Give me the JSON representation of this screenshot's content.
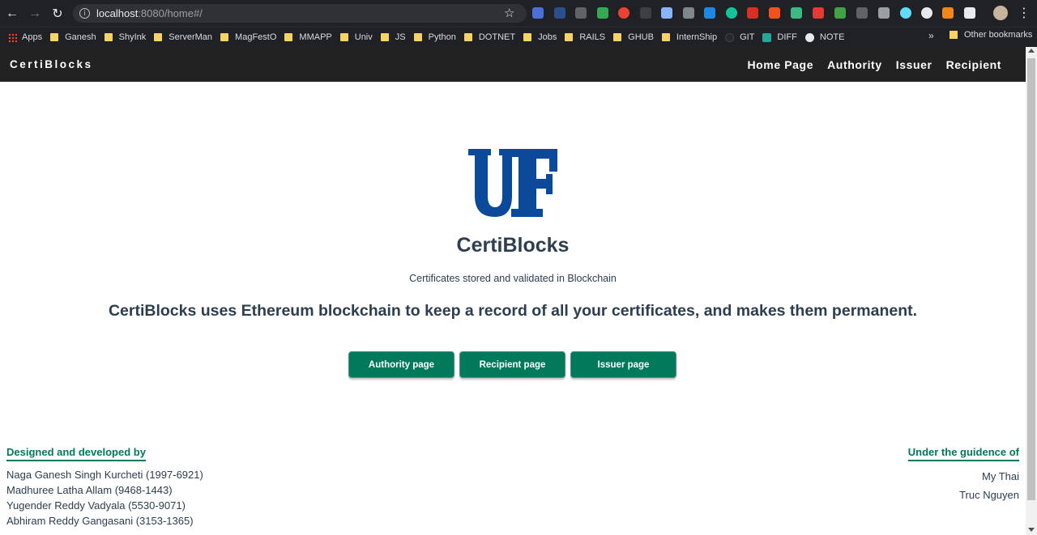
{
  "browser": {
    "url_host": "localhost",
    "url_path": ":8080/home#/",
    "bookmarks": [
      {
        "label": "Apps",
        "icon": "apps-grid-icon"
      },
      {
        "label": "Ganesh",
        "icon": "folder-icon"
      },
      {
        "label": "ShyInk",
        "icon": "folder-icon"
      },
      {
        "label": "ServerMan",
        "icon": "folder-icon"
      },
      {
        "label": "MagFestO",
        "icon": "folder-icon"
      },
      {
        "label": "MMAPP",
        "icon": "folder-icon"
      },
      {
        "label": "Univ",
        "icon": "folder-icon"
      },
      {
        "label": "JS",
        "icon": "folder-icon"
      },
      {
        "label": "Python",
        "icon": "folder-icon"
      },
      {
        "label": "DOTNET",
        "icon": "folder-icon"
      },
      {
        "label": "Jobs",
        "icon": "folder-icon"
      },
      {
        "label": "RAILS",
        "icon": "folder-icon"
      },
      {
        "label": "GHUB",
        "icon": "folder-icon"
      },
      {
        "label": "InternShip",
        "icon": "folder-icon"
      },
      {
        "label": "GIT",
        "icon": "github-icon"
      },
      {
        "label": "DIFF",
        "icon": "diff-icon"
      },
      {
        "label": "NOTE",
        "icon": "globe-icon"
      }
    ],
    "more_label": "»",
    "other_bookmarks": "Other bookmarks"
  },
  "navbar": {
    "brand": "CertiBlocks",
    "links": [
      "Home Page",
      "Authority",
      "Issuer",
      "Recipient"
    ]
  },
  "hero": {
    "logo_text": "UF",
    "title": "CertiBlocks",
    "subtitle": "Certificates stored and validated in Blockchain",
    "tagline": "CertiBlocks uses Ethereum blockchain to keep a record of all your certificates, and makes them permanent."
  },
  "buttons": [
    "Authority page",
    "Recipient page",
    "Issuer page"
  ],
  "footer": {
    "left_heading": "Designed and developed by",
    "developers": [
      "Naga Ganesh Singh Kurcheti (1997-6921)",
      "Madhuree Latha Allam (9468-1443)",
      "Yugender Reddy Vadyala (5530-9071)",
      "Abhiram Reddy Gangasani (3153-1365)"
    ],
    "right_heading": "Under the guidence of",
    "guides": [
      "My Thai",
      "Truc Nguyen"
    ]
  },
  "colors": {
    "accent_green": "#007a5a",
    "uf_blue": "#0b4a9b",
    "text_dark": "#2c3e50",
    "navbar_bg": "#222222"
  }
}
